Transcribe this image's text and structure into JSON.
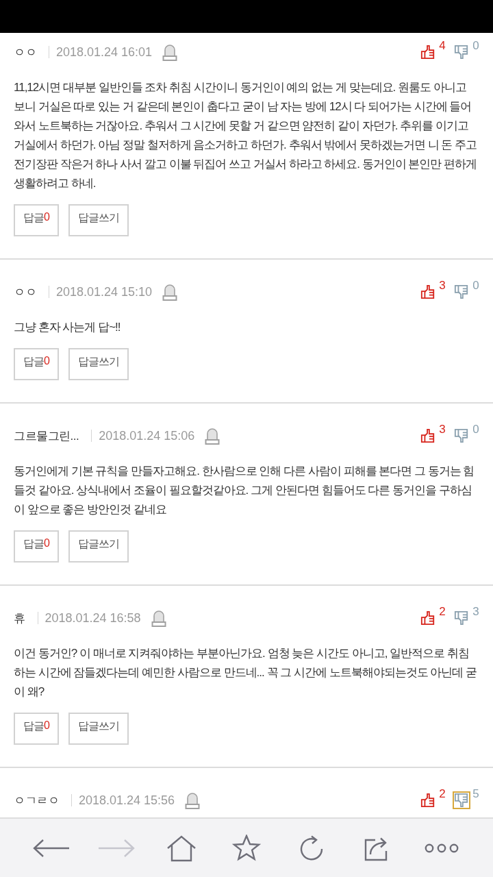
{
  "comments": [
    {
      "author": "ㅇㅇ",
      "date": "2018.01.24 16:01",
      "like": {
        "count": "4",
        "selected": false
      },
      "dislike": {
        "count": "0",
        "selected": false
      },
      "text": "11,12시면 대부분 일반인들 조차 취침 시간이니 동거인이 예의 없는 게 맞는데요. 원룸도 아니고 보니 거실은 따로 있는 거 같은데 본인이 춥다고 굳이 남 자는 방에 12시 다 되어가는 시간에 들어와서 노트북하는 거잖아요. 추워서 그 시간에 못할 거 같으면 얌전히 같이 자던가. 추위를 이기고 거실에서 하던가. 아님 정말 철저하게 음소거하고 하던가. 추워서 밖에서 못하겠는거면 니 돈 주고 전기장판 작은거 하나 사서 깔고 이불 뒤집어 쓰고 거실서 하라고 하세요. 동거인이 본인만 편하게 생활하려고 하네.",
      "reply": {
        "label": "답글",
        "count": "0"
      },
      "write_reply": "답글쓰기"
    },
    {
      "author": "ㅇㅇ",
      "date": "2018.01.24 15:10",
      "like": {
        "count": "3",
        "selected": false
      },
      "dislike": {
        "count": "0",
        "selected": false
      },
      "text": "그냥 혼자 사는게 답~!!",
      "reply": {
        "label": "답글",
        "count": "0"
      },
      "write_reply": "답글쓰기"
    },
    {
      "author": "그르물그린...",
      "date": "2018.01.24 15:06",
      "like": {
        "count": "3",
        "selected": false
      },
      "dislike": {
        "count": "0",
        "selected": false
      },
      "text": "동거인에게 기본 규칙을 만들자고해요. 한사람으로 인해 다른 사람이 피해를 본다면 그 동거는 힘들것 같아요. 상식내에서 조율이 필요할것같아요. 그게 안된다면 힘들어도 다른 동거인을 구하심이 앞으로 좋은 방안인것 같네요",
      "reply": {
        "label": "답글",
        "count": "0"
      },
      "write_reply": "답글쓰기"
    },
    {
      "author": "휴",
      "date": "2018.01.24 16:58",
      "like": {
        "count": "2",
        "selected": false
      },
      "dislike": {
        "count": "3",
        "selected": false
      },
      "text": "이건 동거인? 이 매너로 지켜줘야하는 부분아닌가요. 엄청 늦은 시간도 아니고, 일반적으로 취침하는 시간에 잠들겠다는데 예민한 사람으로 만드네... 꼭 그 시간에 노트북해야되는것도 아닌데 굳이 왜?",
      "reply": {
        "label": "답글",
        "count": "0"
      },
      "write_reply": "답글쓰기"
    },
    {
      "author": "ㅇㄱㄹㅇ",
      "date": "2018.01.24 15:56",
      "like": {
        "count": "2",
        "selected": false
      },
      "dislike": {
        "count": "5",
        "selected": true
      }
    }
  ],
  "toolbar": [
    {
      "kind": "back",
      "disabled": false
    },
    {
      "kind": "forward",
      "disabled": true
    },
    {
      "kind": "home",
      "disabled": false
    },
    {
      "kind": "bookmark",
      "disabled": false
    },
    {
      "kind": "reload",
      "disabled": false
    },
    {
      "kind": "share",
      "disabled": false
    },
    {
      "kind": "more",
      "disabled": false
    }
  ]
}
